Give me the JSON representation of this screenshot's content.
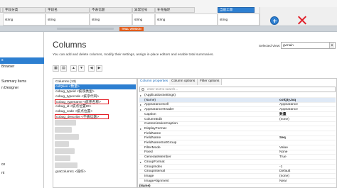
{
  "grid": {
    "headers": [
      "主表ID",
      "字段分类",
      "字段名",
      "不表信题",
      "异常位号",
      "补充描述",
      "当前工单",
      "操作"
    ],
    "row": [
      "",
      "string",
      "string",
      "string",
      "string",
      "string",
      "string",
      ""
    ],
    "add_icon": "plus-circle-icon",
    "delete_icon": "close-x-icon",
    "accent": "#2d7fd1",
    "delete_color": "#e1202a"
  },
  "info_bar": {
    "badge": "TRIAL VERSION",
    "badge_color": "#e25c1a"
  },
  "sidebar": {
    "items": [
      {
        "label": "s",
        "selected": true
      },
      {
        "label": "Browser",
        "selected": false
      },
      {
        "label": "Summary Items",
        "selected": false
      },
      {
        "label": "n Designer",
        "selected": false
      },
      {
        "label": "ce",
        "selected": false
      },
      {
        "label": "nt",
        "selected": false
      }
    ]
  },
  "designer": {
    "title": "Columns",
    "description": "You can add and delete columns, modify their settings, assign in-place editors and enable total summaries.",
    "selected_view_label": "Selected View:",
    "selected_view_value": "gvmain",
    "toolbar": [
      "▦",
      "▤",
      "▲",
      "▼",
      "◀",
      "▶"
    ]
  },
  "columns": {
    "caption": "Columns (13)",
    "items": [
      {
        "label": "colQties <数量>",
        "selected": true,
        "outlined": false
      },
      {
        "label": "cobug_typeid <疵序类型>",
        "selected": false,
        "outlined": false
      },
      {
        "label": "cobug_typecode <疵序代码>",
        "selected": false,
        "outlined": false
      },
      {
        "label": "cobug_typename <疵序名称>",
        "selected": false,
        "outlined": true
      },
      {
        "label": "cobug_id <疵点位置ID>",
        "selected": false,
        "outlined": false
      },
      {
        "label": "cobug_code <疵点位置>",
        "selected": false,
        "outlined": false
      },
      {
        "label": "cobug_describe <不表信题>",
        "selected": false,
        "outlined": true
      },
      {
        "label": "graColumn1 <操作>",
        "selected": false,
        "outlined": false
      }
    ]
  },
  "properties": {
    "tabs": [
      "Column properties",
      "Column options",
      "Filter options"
    ],
    "filter_placeholder": "enter text to search...",
    "rows": [
      {
        "name": "(ApplicationSettings)",
        "value": "",
        "expandable": true,
        "selected": false,
        "bold": false
      },
      {
        "name": "(Name)",
        "value": "colQtyJxq",
        "expandable": false,
        "selected": true,
        "bold": true
      },
      {
        "name": "AppearanceCell",
        "value": "Appearance",
        "expandable": true,
        "selected": false,
        "bold": false
      },
      {
        "name": "AppearanceHeader",
        "value": "Appearance",
        "expandable": true,
        "selected": false,
        "bold": false
      },
      {
        "name": "Caption",
        "value": "数量",
        "expandable": false,
        "selected": false,
        "bold": true
      },
      {
        "name": "ColumnEdit",
        "value": "(none)",
        "expandable": false,
        "selected": false,
        "bold": false
      },
      {
        "name": "CustomizationCaption",
        "value": "",
        "expandable": false,
        "selected": false,
        "bold": false
      },
      {
        "name": "DisplayFormat",
        "value": "",
        "expandable": true,
        "selected": false,
        "bold": false
      },
      {
        "name": "FieldName",
        "value": "",
        "expandable": false,
        "selected": false,
        "bold": false
      },
      {
        "name": "FieldName",
        "value": "Seq",
        "expandable": false,
        "selected": false,
        "bold": true
      },
      {
        "name": "FieldNameSortGroup",
        "value": "",
        "expandable": false,
        "selected": false,
        "bold": false
      },
      {
        "name": "FilterMode",
        "value": "Value",
        "expandable": false,
        "selected": false,
        "bold": false
      },
      {
        "name": "Fixed",
        "value": "None",
        "expandable": false,
        "selected": false,
        "bold": false
      },
      {
        "name": "GenerateMember",
        "value": "True",
        "expandable": false,
        "selected": false,
        "bold": false
      },
      {
        "name": "GroupFormat",
        "value": "",
        "expandable": true,
        "selected": false,
        "bold": false
      },
      {
        "name": "GroupIndex",
        "value": "-1",
        "expandable": false,
        "selected": false,
        "bold": false
      },
      {
        "name": "GroupInterval",
        "value": "Default",
        "expandable": false,
        "selected": false,
        "bold": false
      },
      {
        "name": "Image",
        "value": "(none)",
        "expandable": false,
        "selected": false,
        "bold": false
      },
      {
        "name": "ImageAlignment",
        "value": "Near",
        "expandable": false,
        "selected": false,
        "bold": false
      }
    ],
    "description_title": "(Name)"
  }
}
